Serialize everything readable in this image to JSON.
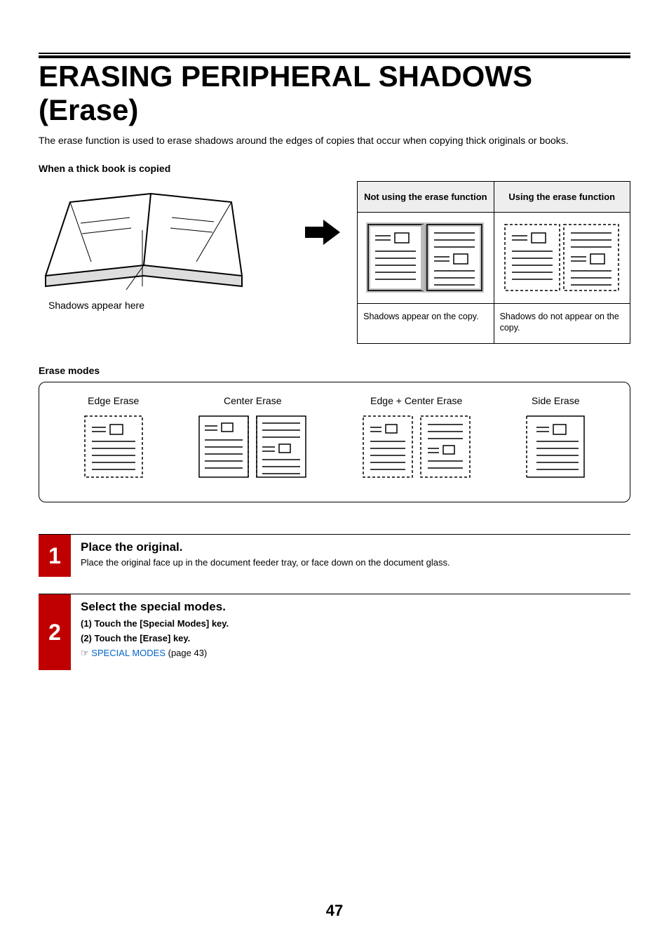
{
  "title": "ERASING PERIPHERAL SHADOWS (Erase)",
  "intro": "The erase function is used to erase shadows around the edges of copies that occur when copying thick originals or books.",
  "sub1": "When a thick book is copied",
  "book_caption": "Shadows appear here",
  "compare": {
    "left_head": "Not using the erase function",
    "right_head": "Using the erase function",
    "left_caption": "Shadows appear on the copy.",
    "right_caption": "Shadows do not appear on the copy."
  },
  "modes_label": "Erase modes",
  "modes": {
    "edge": "Edge Erase",
    "center": "Center Erase",
    "edge_center": "Edge + Center Erase",
    "side": "Side Erase"
  },
  "step1": {
    "num": "1",
    "title": "Place the original.",
    "text": "Place the original face up in the document feeder tray, or face down on the document glass."
  },
  "step2": {
    "num": "2",
    "title": "Select the special modes.",
    "line1": "(1)  Touch the [Special Modes] key.",
    "line2": "(2)  Touch the [Erase] key.",
    "ref_prefix": "☞",
    "ref": "SPECIAL MODES",
    "ref_page": " (page 43)"
  },
  "page_num": "47"
}
